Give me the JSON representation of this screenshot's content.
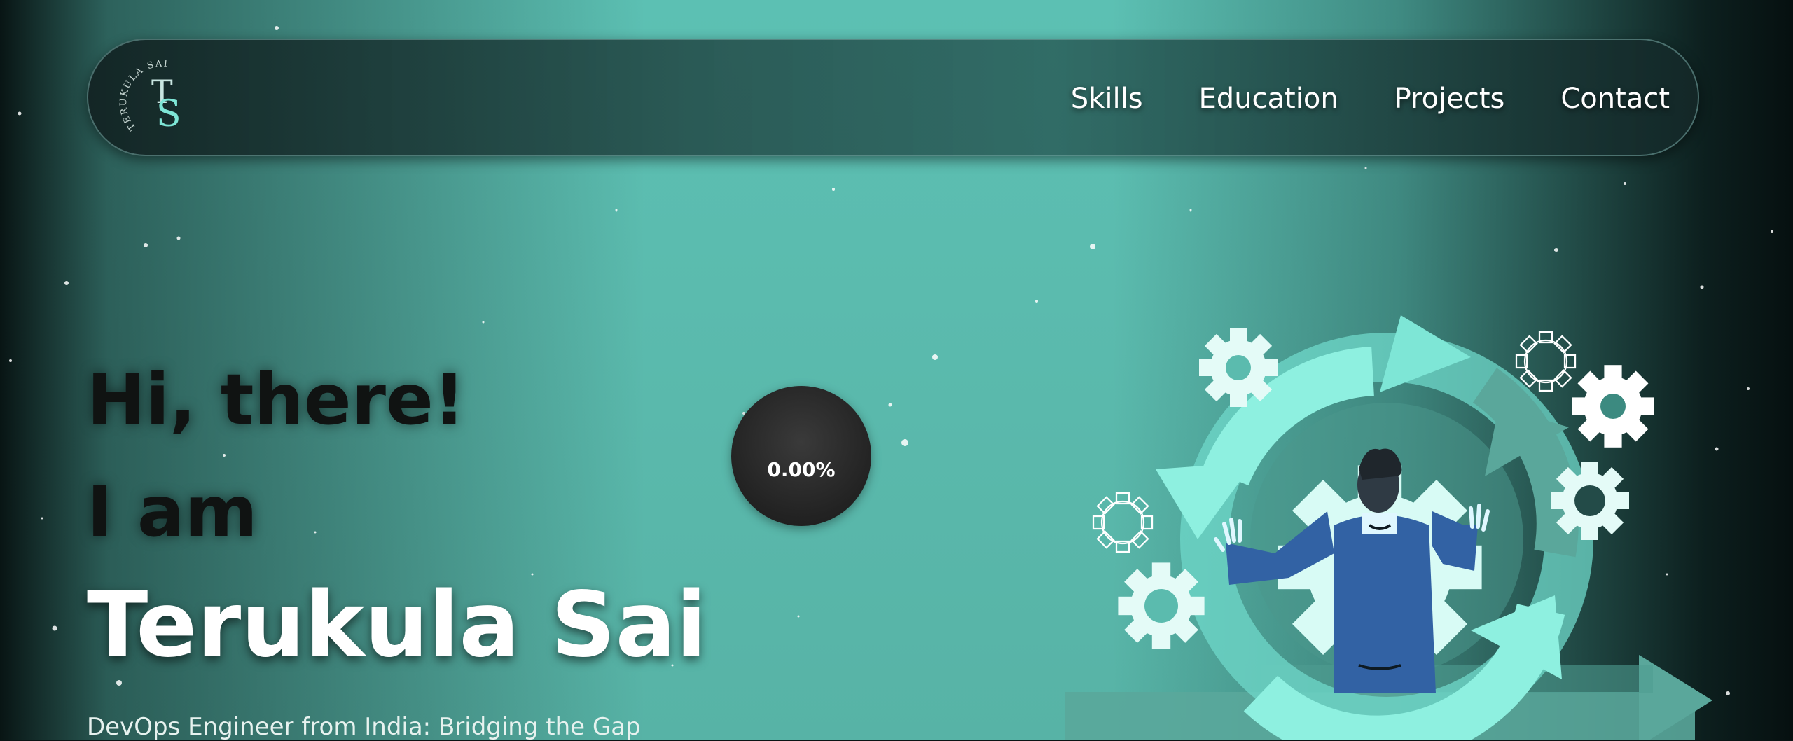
{
  "nav": {
    "logo": {
      "initials": "TS",
      "arc_text": "TERUKULA SAI"
    },
    "links": [
      "Skills",
      "Education",
      "Projects",
      "Contact"
    ]
  },
  "hero": {
    "greeting": "Hi, there!",
    "intro": "I am",
    "name": "Terukula Sai",
    "tagline": "DevOps Engineer from India: Bridging the Gap"
  },
  "loader": {
    "value": "0.00%"
  },
  "illustration": {
    "icon": "devops-cycle-illustration"
  },
  "colors": {
    "accent": "#7ee6d6",
    "background": "#5bbbae",
    "nav_bg": "#234b48",
    "text_dark": "#101312",
    "text_light": "#ffffff",
    "person_suit": "#3262a4"
  }
}
